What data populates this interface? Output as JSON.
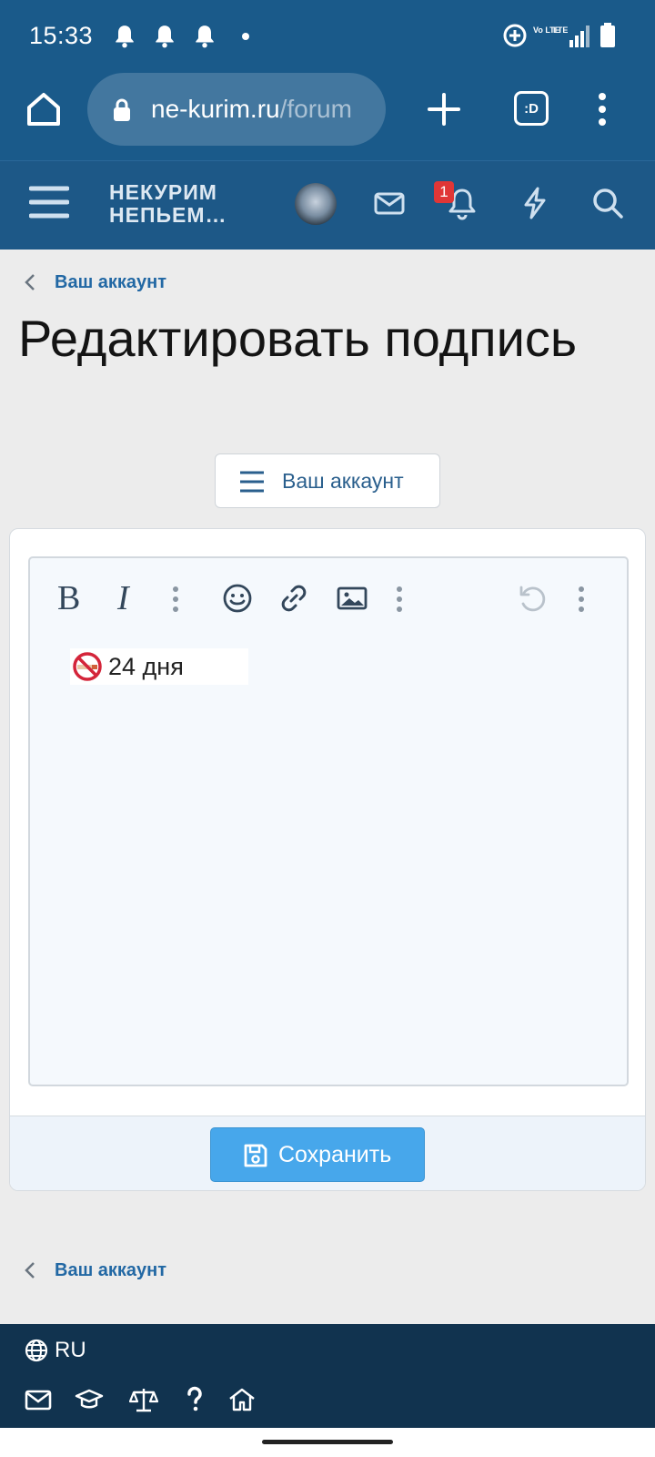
{
  "status_bar": {
    "time": "15:33",
    "network_top": "Vo LTE",
    "network_mid": "LTE",
    "icons": [
      "bell-icon",
      "bell-icon",
      "bell-icon",
      "data-saver-icon",
      "signal-icon",
      "battery-icon"
    ]
  },
  "browser": {
    "url_host": "ne-kurim.ru",
    "url_path": "/forum",
    "tabs_label": ":D"
  },
  "site_header": {
    "logo_line1": "НЕКУРИМ",
    "logo_line2": "НЕПЬЕМ…",
    "notification_count": "1"
  },
  "breadcrumb": {
    "top_label": "Ваш аккаунт",
    "bottom_label": "Ваш аккаунт"
  },
  "page": {
    "title": "Редактировать подпись",
    "account_menu_label": "Ваш аккаунт"
  },
  "editor": {
    "toolbar": {
      "bold_label": "B",
      "italic_label": "I"
    },
    "content_text": "24 дня"
  },
  "form": {
    "save_label": "Сохранить"
  },
  "footer": {
    "language": "RU"
  },
  "colors": {
    "header_bg": "#1d5887",
    "footer_bg": "#11334f",
    "link": "#2268a4",
    "save_button": "#47a7eb",
    "badge": "#e03636"
  }
}
